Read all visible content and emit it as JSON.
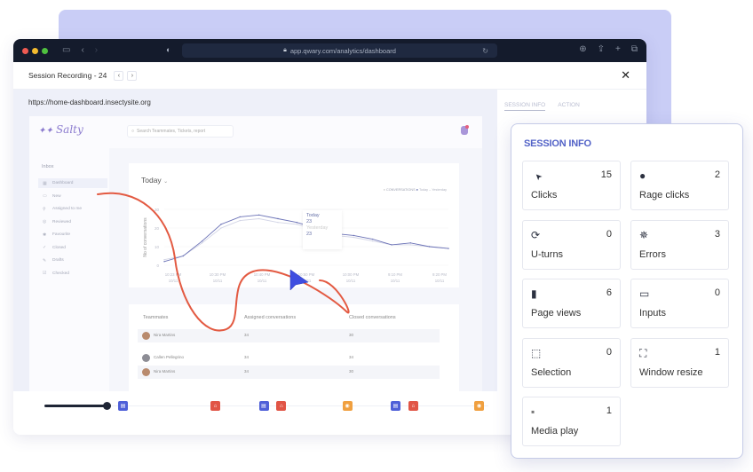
{
  "browser": {
    "url": "app.qwary.com/analytics/dashboard",
    "traffic_lights": [
      "#ee5a52",
      "#f4bb2f",
      "#4fc13f"
    ]
  },
  "recording": {
    "title": "Session Recording - 24",
    "prev_label": "‹",
    "next_label": "›",
    "close_label": "✕",
    "site_url": "https://home-dashboard.insectysite.org"
  },
  "right_tabs": [
    {
      "label": "SESSION INFO",
      "active": true
    },
    {
      "label": "ACTION",
      "active": false
    }
  ],
  "app": {
    "logo": "Salty",
    "search_placeholder": "Search Teammates, Tickets, report",
    "sidebar": {
      "heading": "Inbox",
      "items": [
        {
          "label": "Dashboard",
          "icon": "dashboard-icon",
          "active": true
        },
        {
          "label": "New",
          "icon": "inbox-icon"
        },
        {
          "label": "Assigned to me",
          "icon": "user-icon"
        },
        {
          "label": "Reviewed",
          "icon": "review-icon"
        },
        {
          "label": "Favourite",
          "icon": "star-icon"
        },
        {
          "label": "Closed",
          "icon": "check-icon"
        },
        {
          "label": "Drafts",
          "icon": "pencil-icon"
        },
        {
          "label": "Checked",
          "icon": "checkbox-icon"
        }
      ]
    },
    "chart_card": {
      "period": "Today",
      "legend": {
        "title": "CONVERSATIONS",
        "today": "Today",
        "yesterday": "Yesterday"
      },
      "tooltip": {
        "today_label": "Today",
        "today_value": "23",
        "yesterday_label": "Yesterday",
        "yesterday_value": "23"
      }
    },
    "table": {
      "headers": [
        "Teammates",
        "Assigned conversations",
        "Closed conversations"
      ],
      "rows": [
        {
          "name": "Nira Martins",
          "assigned": "34",
          "closed": "30"
        },
        {
          "name": "Callen Pellegrino",
          "assigned": "34",
          "closed": "34"
        },
        {
          "name": "Nira Martins",
          "assigned": "34",
          "closed": "30"
        }
      ]
    }
  },
  "timeline": {
    "progress": 0.22,
    "markers": [
      {
        "type": "page-view",
        "pos": 0.18
      },
      {
        "type": "rage-click",
        "pos": 0.39
      },
      {
        "type": "page-view",
        "pos": 0.5
      },
      {
        "type": "rage-click",
        "pos": 0.54
      },
      {
        "type": "error",
        "pos": 0.69
      },
      {
        "type": "page-view",
        "pos": 0.8
      },
      {
        "type": "rage-click",
        "pos": 0.84
      },
      {
        "type": "error",
        "pos": 0.99
      }
    ]
  },
  "session_info": {
    "title": "SESSION INFO",
    "tiles": [
      {
        "label": "Clicks",
        "count": "15",
        "icon": "cursor-icon"
      },
      {
        "label": "Rage clicks",
        "count": "2",
        "icon": "angry-face-icon"
      },
      {
        "label": "U-turns",
        "count": "0",
        "icon": "refresh-icon"
      },
      {
        "label": "Errors",
        "count": "3",
        "icon": "bug-icon"
      },
      {
        "label": "Page views",
        "count": "6",
        "icon": "document-icon"
      },
      {
        "label": "Inputs",
        "count": "0",
        "icon": "input-box-icon"
      },
      {
        "label": "Selection",
        "count": "0",
        "icon": "selection-icon"
      },
      {
        "label": "Window resize",
        "count": "1",
        "icon": "resize-icon"
      },
      {
        "label": "Media play",
        "count": "1",
        "icon": "media-icon"
      }
    ]
  },
  "chart_data": {
    "type": "line",
    "title": "",
    "xlabel": "",
    "ylabel": "No of conversations",
    "x": [
      "10:23 PM 10/11",
      "10:30 PM 10/11",
      "10:40 PM 10/11",
      "10:50 PM 10/11",
      "10:00 PM 10/11",
      "9:10 PM 10/11",
      "9:20 PM 10/11"
    ],
    "ytick_labels": [
      "0",
      "10",
      "20",
      "30"
    ],
    "ylim": [
      0,
      30
    ],
    "grid": true,
    "legend": "top-right",
    "series": [
      {
        "name": "Today",
        "values": [
          2,
          5,
          13,
          22,
          26,
          27,
          25,
          23,
          20,
          17,
          16,
          14,
          11,
          12,
          10,
          9
        ]
      },
      {
        "name": "Yesterday",
        "values": [
          3,
          5,
          12,
          20,
          24,
          25,
          23,
          22,
          19,
          16,
          15,
          13,
          11,
          11,
          10,
          9
        ]
      }
    ]
  }
}
